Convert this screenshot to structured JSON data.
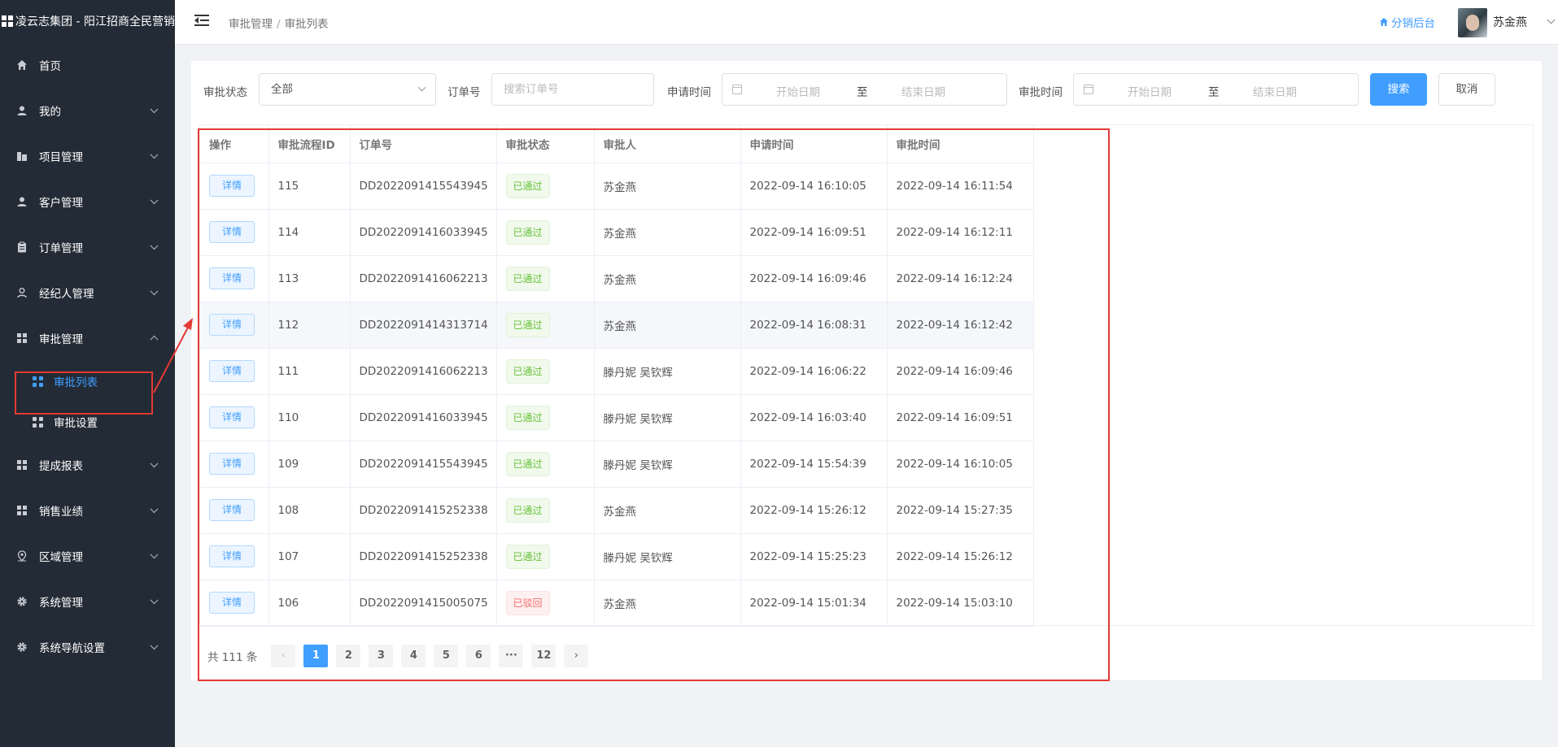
{
  "brand": {
    "title": "凌云志集团 - 阳江招商全民营销"
  },
  "sidebar": {
    "items": [
      {
        "label": "首页",
        "icon": "home-icon",
        "has_children": false
      },
      {
        "label": "我的",
        "icon": "user-icon",
        "has_children": true
      },
      {
        "label": "项目管理",
        "icon": "building-icon",
        "has_children": true
      },
      {
        "label": "客户管理",
        "icon": "user-icon",
        "has_children": true
      },
      {
        "label": "订单管理",
        "icon": "clipboard-icon",
        "has_children": true
      },
      {
        "label": "经纪人管理",
        "icon": "user-outline-icon",
        "has_children": true
      },
      {
        "label": "审批管理",
        "icon": "grid-icon",
        "has_children": true,
        "expanded": true
      },
      {
        "label": "提成报表",
        "icon": "grid-icon",
        "has_children": true
      },
      {
        "label": "销售业绩",
        "icon": "grid-icon",
        "has_children": true
      },
      {
        "label": "区域管理",
        "icon": "location-icon",
        "has_children": true
      },
      {
        "label": "系统管理",
        "icon": "gear-icon",
        "has_children": true
      },
      {
        "label": "系统导航设置",
        "icon": "gear-icon",
        "has_children": true
      }
    ],
    "sub_items": [
      {
        "label": "审批列表",
        "active": true
      },
      {
        "label": "审批设置",
        "active": false
      }
    ]
  },
  "header": {
    "breadcrumb": [
      "审批管理",
      "审批列表"
    ],
    "link_label": "分销后台",
    "username": "苏金燕"
  },
  "filters": {
    "status_label": "审批状态",
    "status_value": "全部",
    "order_label": "订单号",
    "order_placeholder": "搜索订单号",
    "apply_time_label": "申请时间",
    "approve_time_label": "审批时间",
    "start_placeholder": "开始日期",
    "range_separator": "至",
    "end_placeholder": "结束日期",
    "search_button": "搜索",
    "cancel_button": "取消"
  },
  "table": {
    "columns": [
      "操作",
      "审批流程ID",
      "订单号",
      "审批状态",
      "审批人",
      "申请时间",
      "审批时间"
    ],
    "action_label": "详情",
    "rows": [
      {
        "id": "115",
        "order": "DD2022091415543945",
        "status": "已通过",
        "status_type": "success",
        "approver": "苏金燕",
        "apply_time": "2022-09-14 16:10:05",
        "approve_time": "2022-09-14 16:11:54"
      },
      {
        "id": "114",
        "order": "DD2022091416033945",
        "status": "已通过",
        "status_type": "success",
        "approver": "苏金燕",
        "apply_time": "2022-09-14 16:09:51",
        "approve_time": "2022-09-14 16:12:11"
      },
      {
        "id": "113",
        "order": "DD2022091416062213",
        "status": "已通过",
        "status_type": "success",
        "approver": "苏金燕",
        "apply_time": "2022-09-14 16:09:46",
        "approve_time": "2022-09-14 16:12:24"
      },
      {
        "id": "112",
        "order": "DD2022091414313714",
        "status": "已通过",
        "status_type": "success",
        "approver": "苏金燕",
        "apply_time": "2022-09-14 16:08:31",
        "approve_time": "2022-09-14 16:12:42"
      },
      {
        "id": "111",
        "order": "DD2022091416062213",
        "status": "已通过",
        "status_type": "success",
        "approver": "滕丹妮 吴钦辉",
        "apply_time": "2022-09-14 16:06:22",
        "approve_time": "2022-09-14 16:09:46"
      },
      {
        "id": "110",
        "order": "DD2022091416033945",
        "status": "已通过",
        "status_type": "success",
        "approver": "滕丹妮 吴钦辉",
        "apply_time": "2022-09-14 16:03:40",
        "approve_time": "2022-09-14 16:09:51"
      },
      {
        "id": "109",
        "order": "DD2022091415543945",
        "status": "已通过",
        "status_type": "success",
        "approver": "滕丹妮 吴钦辉",
        "apply_time": "2022-09-14 15:54:39",
        "approve_time": "2022-09-14 16:10:05"
      },
      {
        "id": "108",
        "order": "DD2022091415252338",
        "status": "已通过",
        "status_type": "success",
        "approver": "苏金燕",
        "apply_time": "2022-09-14 15:26:12",
        "approve_time": "2022-09-14 15:27:35"
      },
      {
        "id": "107",
        "order": "DD2022091415252338",
        "status": "已通过",
        "status_type": "success",
        "approver": "滕丹妮 吴钦辉",
        "apply_time": "2022-09-14 15:25:23",
        "approve_time": "2022-09-14 15:26:12"
      },
      {
        "id": "106",
        "order": "DD2022091415005075",
        "status": "已驳回",
        "status_type": "danger",
        "approver": "苏金燕",
        "apply_time": "2022-09-14 15:01:34",
        "approve_time": "2022-09-14 15:03:10"
      }
    ]
  },
  "pagination": {
    "total_text": "共 111 条",
    "pages": [
      "1",
      "2",
      "3",
      "4",
      "5",
      "6",
      "···",
      "12"
    ],
    "current": "1",
    "prev": "‹",
    "next": "›"
  },
  "colors": {
    "sidebar_bg": "#232b36",
    "accent": "#409eff",
    "annotation": "#e53935",
    "success": "#67c23a",
    "danger": "#f56c6c"
  }
}
